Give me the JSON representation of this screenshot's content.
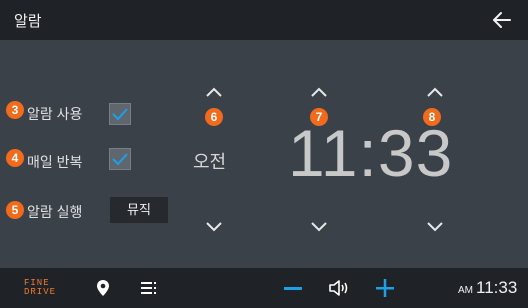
{
  "header": {
    "title": "알람",
    "back_icon": "arrow-left-icon"
  },
  "settings": {
    "alarm_use": {
      "badge": "3",
      "label": "알람 사용",
      "checked": true
    },
    "repeat_daily": {
      "badge": "4",
      "label": "매일 반복",
      "checked": true
    },
    "alarm_action": {
      "badge": "5",
      "label": "알람 실행",
      "button": "뮤직"
    }
  },
  "time_picker": {
    "ampm": {
      "badge": "6",
      "value": "오전"
    },
    "hour": {
      "badge": "7",
      "value": "11"
    },
    "minute": {
      "badge": "8",
      "value": "33"
    },
    "separator": ":"
  },
  "bottom_bar": {
    "logo_line1": "FINE",
    "logo_line2": "DRIVE",
    "clock_ampm": "AM",
    "clock_time": "11:33",
    "icons": [
      "location-pin-icon",
      "menu-icon",
      "volume-down-icon",
      "speaker-icon",
      "volume-up-icon"
    ]
  },
  "colors": {
    "accent": "#1ea0e6",
    "badge": "#f26a1b",
    "background": "#3a4149",
    "bar": "#1f2226"
  }
}
